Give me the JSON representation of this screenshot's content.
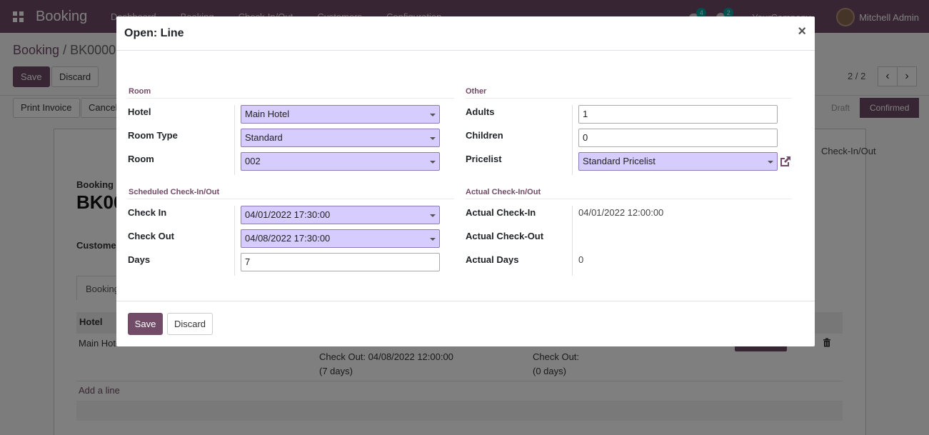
{
  "app": {
    "brand": "Booking",
    "menu": [
      "Dashboard",
      "Booking",
      "Check-In/Out",
      "Customers",
      "Configuration"
    ],
    "chat_count": "4",
    "activity_count": "2",
    "company": "YourCompany",
    "user": "Mitchell Admin"
  },
  "background": {
    "breadcrumb_root": "Booking",
    "breadcrumb_sep": "/",
    "breadcrumb_current": "BK00001",
    "save_label": "Save",
    "discard_label": "Discard",
    "pager": "2 / 2",
    "print_invoice_label": "Print Invoice",
    "cancel_label": "Cancel",
    "statuses": [
      "Draft",
      "Confirmed"
    ],
    "smart_button": "Check-In/Out",
    "booking_label": "Booking",
    "booking_ref": "BK00001",
    "customer_label": "Customer",
    "tab_label": "Booking",
    "col_hotel": "Hotel",
    "row_hotel": "Main Hotel",
    "row_checkout_scheduled": "Check Out: 04/08/2022 12:00:00",
    "row_days_scheduled": "(7 days)",
    "row_checkout_actual": "Check Out:",
    "row_days_actual": "(0 days)",
    "add_line": "Add a line"
  },
  "modal": {
    "title": "Open: Line",
    "close": "×",
    "room_group": {
      "title": "Room",
      "hotel_label": "Hotel",
      "hotel_value": "Main Hotel",
      "room_type_label": "Room Type",
      "room_type_value": "Standard",
      "room_label": "Room",
      "room_value": "002"
    },
    "other_group": {
      "title": "Other",
      "adults_label": "Adults",
      "adults_value": "1",
      "children_label": "Children",
      "children_value": "0",
      "pricelist_label": "Pricelist",
      "pricelist_value": "Standard Pricelist"
    },
    "scheduled_group": {
      "title": "Scheduled Check-In/Out",
      "check_in_label": "Check In",
      "check_in_value": "04/01/2022 17:30:00",
      "check_out_label": "Check Out",
      "check_out_value": "04/08/2022 17:30:00",
      "days_label": "Days",
      "days_value": "7"
    },
    "actual_group": {
      "title": "Actual Check-In/Out",
      "actual_check_in_label": "Actual Check-In",
      "actual_check_in_value": "04/01/2022 12:00:00",
      "actual_check_out_label": "Actual Check-Out",
      "actual_check_out_value": "",
      "actual_days_label": "Actual Days",
      "actual_days_value": "0"
    },
    "footer": {
      "save_label": "Save",
      "discard_label": "Discard"
    }
  },
  "colors": {
    "brand": "#714B67",
    "select_bg": "#d6ccfe"
  },
  "icons": {
    "apps": "apps-grid-icon",
    "close": "close-icon",
    "external": "external-link-icon",
    "trash": "trash-icon"
  }
}
